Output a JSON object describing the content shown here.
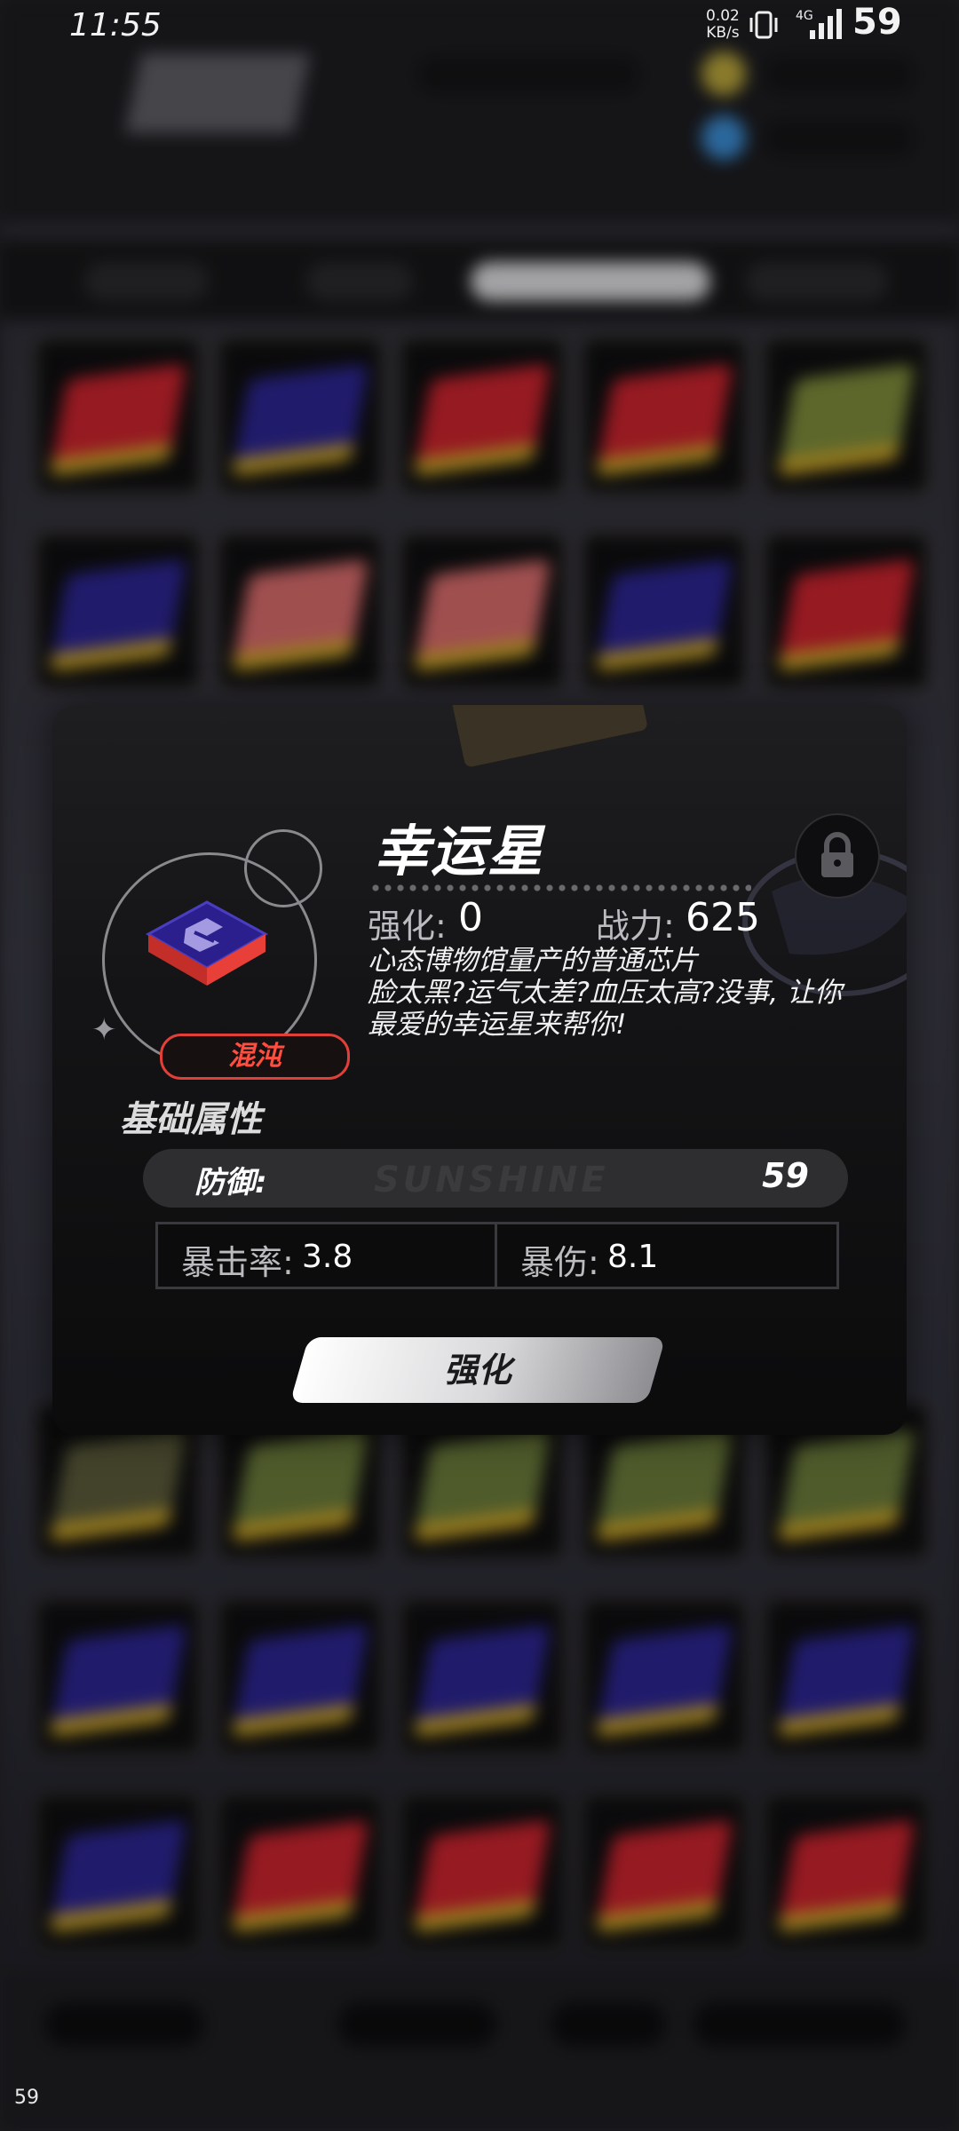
{
  "status_bar": {
    "time": "11:55",
    "net_speed_value": "0.02",
    "net_speed_unit": "KB/s",
    "network_type": "4G",
    "battery": "59",
    "icons": [
      "vibrate-icon",
      "signal-icon"
    ]
  },
  "modal": {
    "item_name": "幸运星",
    "rarity": "混沌",
    "enhance_label": "强化:",
    "enhance_value": "0",
    "power_label": "战力:",
    "power_value": "625",
    "description": "心态博物馆量产的普通芯片\n脸太黑?运气太差?血压太高?没事, 让你最爱的幸运星来帮你!",
    "section_title": "基础属性",
    "main_stat_label": "防御:",
    "main_stat_value": "59",
    "sub_stats": [
      {
        "label": "暴击率:",
        "value": "3.8"
      },
      {
        "label": "暴伤:",
        "value": "8.1"
      }
    ],
    "enhance_button": "强化",
    "colors": {
      "rarity": "#ff4e40",
      "chip_top": "#2a1f8c",
      "chip_side": "#e03a32"
    }
  },
  "fps_counter": "59"
}
